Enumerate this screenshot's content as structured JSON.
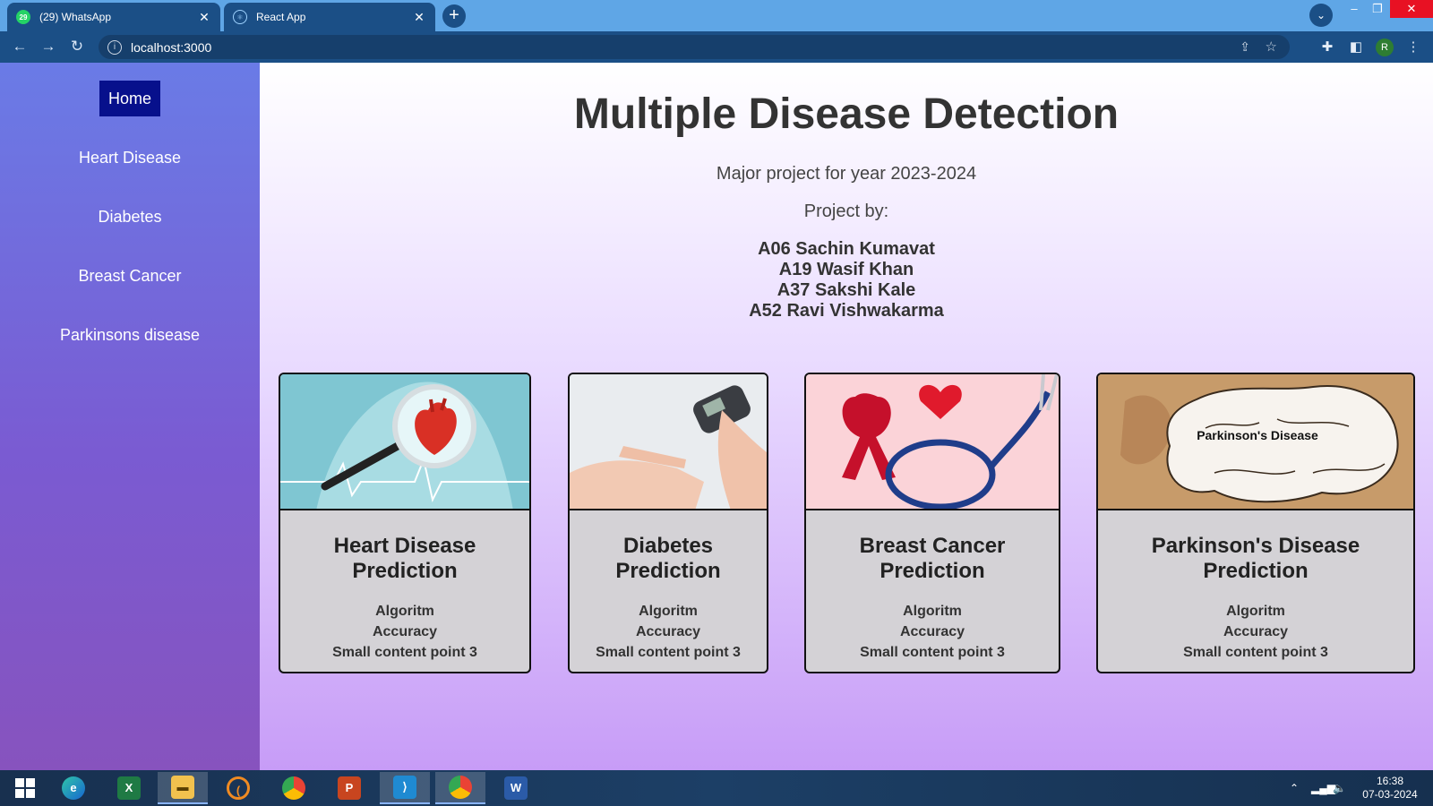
{
  "browser": {
    "tabs": [
      {
        "label": "(29) WhatsApp",
        "badge": "29"
      },
      {
        "label": "React App"
      }
    ],
    "close_glyph": "✕",
    "new_tab_glyph": "+",
    "url": "localhost:3000",
    "profile_initial": "R"
  },
  "sidebar": {
    "items": [
      {
        "label": "Home"
      },
      {
        "label": "Heart Disease"
      },
      {
        "label": "Diabetes"
      },
      {
        "label": "Breast Cancer"
      },
      {
        "label": "Parkinsons disease"
      }
    ]
  },
  "main": {
    "title": "Multiple Disease Detection",
    "subtitle": "Major project for year 2023-2024",
    "byline": "Project by:",
    "members": [
      "A06 Sachin Kumavat",
      "A19 Wasif Khan",
      "A37 Sakshi Kale",
      "A52 Ravi Vishwakarma"
    ]
  },
  "cards": [
    {
      "title": "Heart Disease Prediction",
      "points": [
        "Algoritm",
        "Accuracy",
        "Small content point 3"
      ]
    },
    {
      "title": "Diabetes Prediction",
      "points": [
        "Algoritm",
        "Accuracy",
        "Small content point 3"
      ]
    },
    {
      "title": "Breast Cancer Prediction",
      "points": [
        "Algoritm",
        "Accuracy",
        "Small content point 3"
      ]
    },
    {
      "title": "Parkinson's Disease Prediction",
      "image_text": "Parkinson's Disease",
      "points": [
        "Algoritm",
        "Accuracy",
        "Small content point 3"
      ]
    }
  ],
  "taskbar": {
    "time": "16:38",
    "date": "07-03-2024",
    "apps": [
      "start-icon",
      "edge-icon",
      "excel-icon",
      "file-explorer-icon",
      "eclipse-icon",
      "chrome-icon",
      "powerpoint-icon",
      "vscode-icon",
      "chrome-icon",
      "word-icon"
    ]
  },
  "colors": {
    "tab_strip": "#5fa6e6",
    "chrome_dark": "#1b4f86",
    "home_active": "#07108c",
    "sidebar_top": "#6a7be6",
    "sidebar_bottom": "#8753be",
    "card_bg": "#d4d2d6"
  }
}
